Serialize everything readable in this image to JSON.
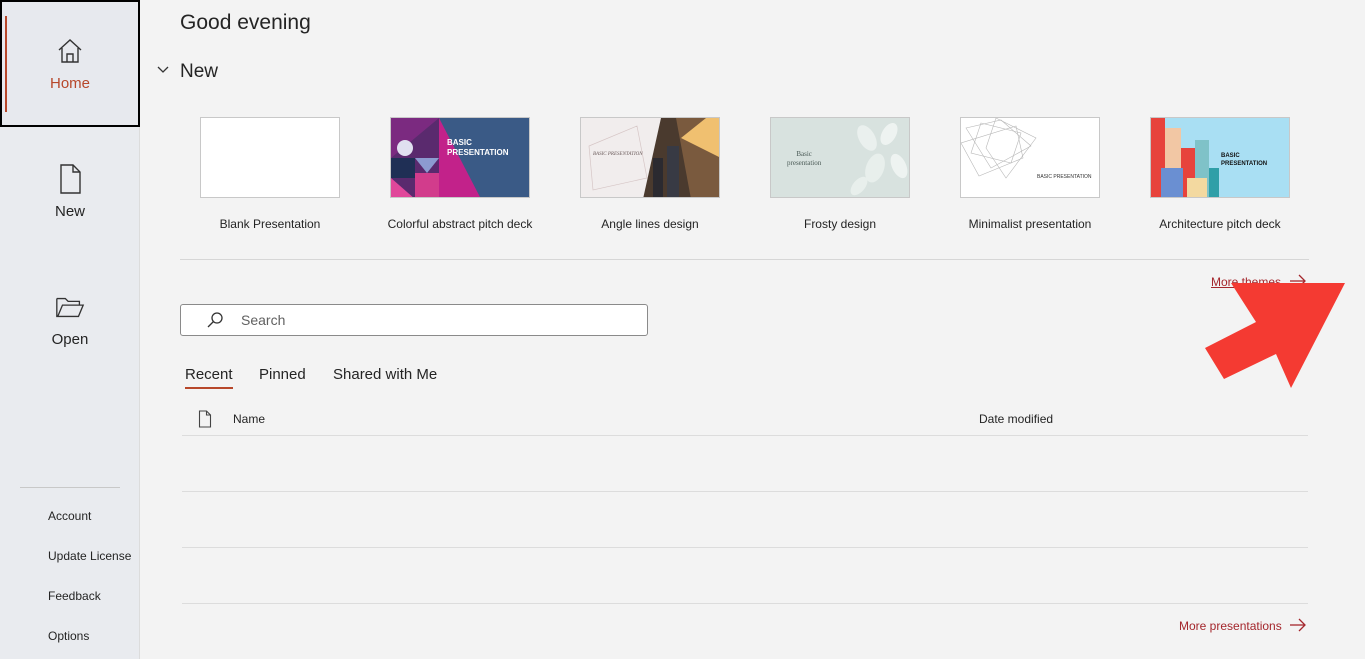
{
  "sidebar": {
    "nav": [
      {
        "label": "Home",
        "icon": "home-icon",
        "active": true
      },
      {
        "label": "New",
        "icon": "new-document-icon",
        "active": false
      },
      {
        "label": "Open",
        "icon": "folder-open-icon",
        "active": false
      }
    ],
    "links": [
      "Account",
      "Update License",
      "Feedback",
      "Options"
    ]
  },
  "main": {
    "greeting": "Good evening",
    "new_heading": "New",
    "templates": [
      {
        "label": "Blank Presentation",
        "thumb_text": ""
      },
      {
        "label": "Colorful abstract pitch deck",
        "thumb_text": "BASIC\nPRESENTATION"
      },
      {
        "label": "Angle lines design",
        "thumb_text": "BASIC PRESENTATION"
      },
      {
        "label": "Frosty design",
        "thumb_text": "Basic presentation"
      },
      {
        "label": "Minimalist presentation",
        "thumb_text": "BASIC PRESENTATION"
      },
      {
        "label": "Architecture pitch deck",
        "thumb_text": "BASIC\nPRESENTATION"
      }
    ],
    "more_themes": "More themes",
    "search": {
      "placeholder": "Search",
      "value": ""
    },
    "tabs": [
      "Recent",
      "Pinned",
      "Shared with Me"
    ],
    "columns": {
      "name": "Name",
      "date": "Date modified"
    },
    "more_presentations": "More presentations"
  },
  "colors": {
    "accent": "#b7472a",
    "link": "#a4262c",
    "annotation_arrow": "#f43a32"
  }
}
